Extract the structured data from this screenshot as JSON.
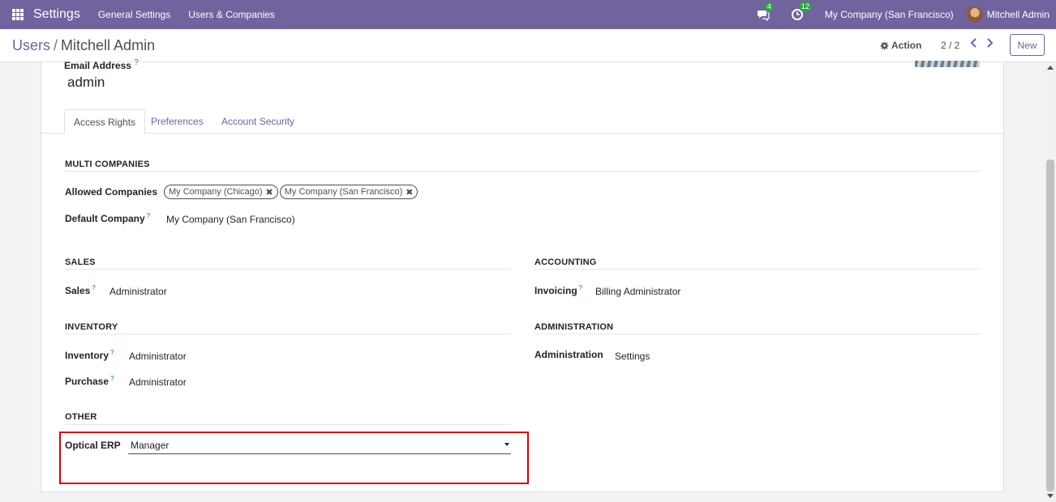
{
  "navbar": {
    "app_title": "Settings",
    "menu": [
      "General Settings",
      "Users & Companies"
    ],
    "messages_count": "4",
    "activities_count": "12",
    "company": "My Company (San Francisco)",
    "user": "Mitchell Admin",
    "bg_color": "#71639e"
  },
  "control_panel": {
    "breadcrumb_parent": "Users",
    "breadcrumb_separator": "/",
    "breadcrumb_current": "Mitchell Admin",
    "action_label": "Action",
    "pager": "2 / 2",
    "new_label": "New"
  },
  "form": {
    "email_label": "Email Address",
    "email_required_mark": "?",
    "email_value": "admin",
    "tabs": [
      "Access Rights",
      "Preferences",
      "Account Security"
    ],
    "multi_companies": {
      "title": "MULTI COMPANIES",
      "allowed_label": "Allowed Companies",
      "allowed_tags": [
        "My Company (Chicago)",
        "My Company (San Francisco)"
      ],
      "default_label": "Default Company",
      "default_value": "My Company (San Francisco)"
    },
    "sales": {
      "title": "SALES",
      "label": "Sales",
      "value": "Administrator"
    },
    "accounting": {
      "title": "ACCOUNTING",
      "label": "Invoicing",
      "value": "Billing Administrator"
    },
    "inventory": {
      "title": "INVENTORY",
      "inventory_label": "Inventory",
      "inventory_value": "Administrator",
      "purchase_label": "Purchase",
      "purchase_value": "Administrator"
    },
    "administration": {
      "title": "ADMINISTRATION",
      "label": "Administration",
      "value": "Settings"
    },
    "other": {
      "title": "OTHER",
      "label": "Optical ERP",
      "value": "Manager"
    },
    "help_mark": "?"
  },
  "colors": {
    "accent": "#71639e",
    "highlight": "#d40000",
    "badge": "#28a745"
  }
}
